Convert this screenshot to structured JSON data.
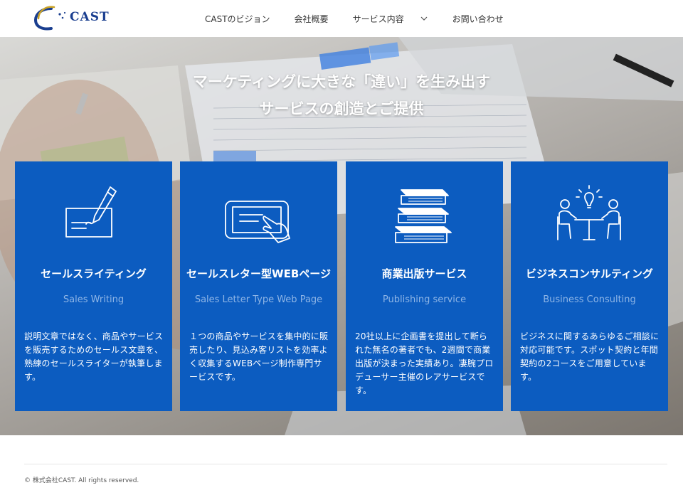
{
  "header": {
    "logo_text": "CAST",
    "nav": [
      {
        "label": "CASTのビジョン"
      },
      {
        "label": "会社概要"
      },
      {
        "label": "サービス内容"
      },
      {
        "label": "お問い合わせ"
      }
    ]
  },
  "hero": {
    "title_line1": "マーケティングに大きな「違い」を生み出す",
    "title_line2": "サービスの創造とご提供"
  },
  "cards": [
    {
      "icon": "writing-check-icon",
      "title": "セールスライティング",
      "subtitle": "Sales Writing",
      "desc": "説明文章ではなく、商品やサービスを販売するためのセールス文章を、熟練のセールスライターが執筆します。"
    },
    {
      "icon": "tablet-touch-icon",
      "title": "セールスレター型WEBページ",
      "subtitle": "Sales Letter Type Web Page",
      "desc": "１つの商品やサービスを集中的に販売したり、見込み客リストを効率よく収集するWEBページ制作専門サービスです。"
    },
    {
      "icon": "books-stack-icon",
      "title": "商業出版サービス",
      "subtitle": "Publishing service",
      "desc": "20社以上に企画書を提出して断られた無名の著者でも、2週間で商業出版が決まった実績あり。凄腕プロデューサー主催のレアサービスです。"
    },
    {
      "icon": "consulting-meeting-icon",
      "title": "ビジネスコンサルティング",
      "subtitle": "Business Consulting",
      "desc": "ビジネスに関するあらゆるご相談に対応可能です。スポット契約と年間契約の2コースをご用意しています。"
    }
  ],
  "footer": {
    "copyright": "© 株式会社CAST. All rights reserved."
  },
  "colors": {
    "card_blue": "#0c5cc0",
    "subtitle_blue": "#8eb5e6",
    "logo_navy": "#1a3e8f"
  }
}
